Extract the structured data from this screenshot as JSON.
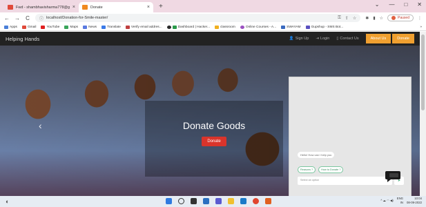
{
  "browser": {
    "tabs": [
      {
        "title": "Fwd - shambhavisharma778@g",
        "active": false
      },
      {
        "title": "Donate",
        "active": true
      }
    ],
    "new_tab_glyph": "+",
    "window_controls": [
      "⌄",
      "—",
      "□",
      "✕"
    ],
    "address": "localhost/Donation-for-Smile-master/",
    "profile_status": "Paused",
    "bookmarks": [
      "Apps",
      "Gmail",
      "YouTube",
      "Maps",
      "News",
      "Translate",
      "Verify email addres...",
      "Dashboard | Hacker...",
      "classroom",
      "Online Courses - A...",
      "SWAYAM",
      "Gupshup - SMS Bot..."
    ],
    "bookmarks_more": "»"
  },
  "site": {
    "brand": "Helping Hands",
    "nav": {
      "signup": "Sign Up",
      "login": "Login",
      "contact": "Contact Us",
      "about": "About Us",
      "donate": "Donate"
    },
    "hero": {
      "heading": "Donate Goods",
      "button": "Donate",
      "prev_arrow": "‹"
    },
    "chat": {
      "greeting": "Hello! How can I help you",
      "options": [
        "Reasons ?",
        "How to Donate ?"
      ],
      "input_placeholder": "Select an option",
      "send_icon": "➤"
    }
  },
  "taskbar": {
    "tray_lang": "ENG",
    "tray_region": "IN",
    "time": "10:04",
    "date": "08-09-2022",
    "tray_symbols": "^  ☁  ◠  ◀)"
  },
  "colors": {
    "navbar": "#222222",
    "about_button": "#f0a030",
    "donate_button": "#d9342b",
    "chat_option_border": "#7bc7a0"
  }
}
